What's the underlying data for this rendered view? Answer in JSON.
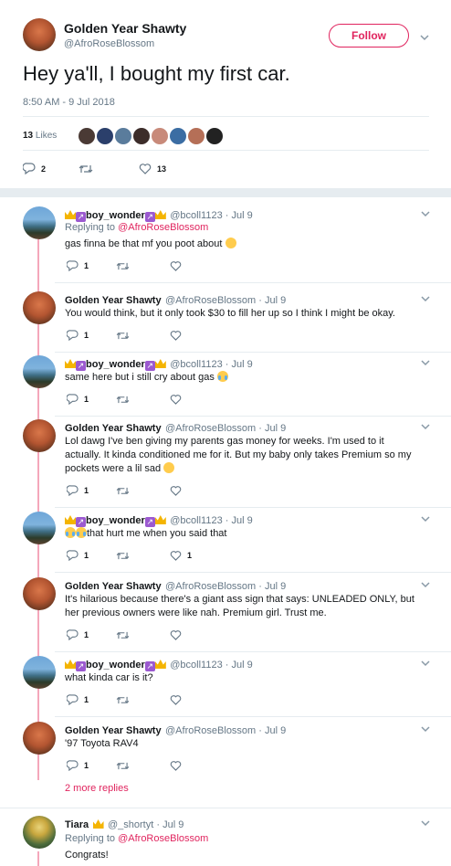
{
  "main_tweet": {
    "author_name": "Golden Year Shawty",
    "author_handle": "@AfroRoseBlossom",
    "follow_label": "Follow",
    "text": "Hey ya'll, I bought my first car.",
    "timestamp": "8:50 AM - 9 Jul 2018",
    "likes_count": "13",
    "likes_label": "Likes",
    "replies": "2",
    "likes": "13"
  },
  "replies": [
    {
      "name": "boy_wonder",
      "handle": "@bcoll1123 · Jul 9",
      "replying_prefix": "Replying to ",
      "replying_to": "@AfroRoseBlossom",
      "text": "gas finna be that mf you poot about",
      "replies": "1",
      "likes": ""
    },
    {
      "name": "Golden Year Shawty",
      "handle": "@AfroRoseBlossom · Jul 9",
      "text": "You would think, but it only took $30 to fill her up so I think I might be okay.",
      "replies": "1",
      "likes": ""
    },
    {
      "name": "boy_wonder",
      "handle": "@bcoll1123 · Jul 9",
      "text": "same here but i still cry about gas",
      "replies": "1",
      "likes": ""
    },
    {
      "name": "Golden Year Shawty",
      "handle": "@AfroRoseBlossom · Jul 9",
      "text_lines": [
        "Lol dawg I've ben giving my parents gas money for weeks. I'm used to it",
        "actually. It kinda conditioned me for it. But my baby only takes Premium so my",
        "pockets were a lil sad"
      ],
      "replies": "1",
      "likes": ""
    },
    {
      "name": "boy_wonder",
      "handle": "@bcoll1123 · Jul 9",
      "text": "that hurt me when you said that",
      "replies": "1",
      "likes": "1"
    },
    {
      "name": "Golden Year Shawty",
      "handle": "@AfroRoseBlossom · Jul 9",
      "text_lines": [
        "It's hilarious because there's a giant ass sign that says: UNLEADED ONLY, but",
        "her previous owners were like nah. Premium girl. Trust me."
      ],
      "replies": "1",
      "likes": ""
    },
    {
      "name": "boy_wonder",
      "handle": "@bcoll1123 · Jul 9",
      "text": "what kinda car is it?",
      "replies": "1",
      "likes": ""
    },
    {
      "name": "Golden Year Shawty",
      "handle": "@AfroRoseBlossom · Jul 9",
      "text": "'97 Toyota RAV4",
      "replies": "1",
      "likes": ""
    }
  ],
  "more_replies": "2 more replies",
  "last_reply": {
    "name": "Tiara",
    "handle": "@_shortyt · Jul 9",
    "replying_prefix": "Replying to ",
    "replying_to": "@AfroRoseBlossom",
    "text": "Congrats!"
  },
  "colors": {
    "accent": "#e0245e",
    "thread": "#f4a7bb",
    "muted": "#657786"
  }
}
